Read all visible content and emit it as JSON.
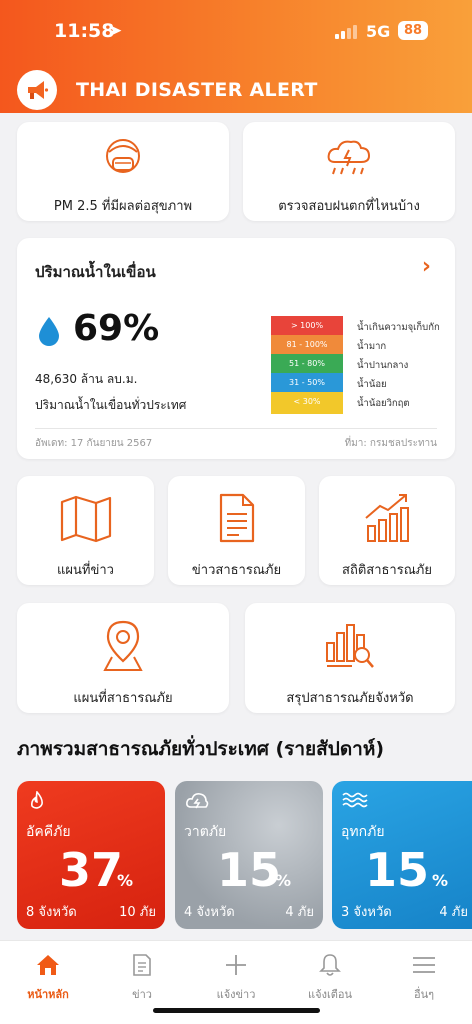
{
  "status_bar": {
    "time": "11:58",
    "network": "5G",
    "battery": "88"
  },
  "app": {
    "title": "THAI DISASTER ALERT"
  },
  "top_tiles": [
    {
      "label": "PM 2.5 ที่มีผลต่อสุขภาพ",
      "icon": "mask-face-icon"
    },
    {
      "label": "ตรวจสอบฝนตกที่ไหนบ้าง",
      "icon": "rain-cloud-icon"
    }
  ],
  "dam": {
    "title": "ปริมาณน้ำในเขื่อน",
    "percent": "69%",
    "volume": "48,630 ล้าน ลบ.ม.",
    "caption": "ปริมาณน้ำในเขื่อนทั่วประเทศ",
    "levels": [
      {
        "label": "> 100%",
        "color": "#e8443a"
      },
      {
        "label": "81 - 100%",
        "color": "#f08a3a"
      },
      {
        "label": "51 - 80%",
        "color": "#3aaa55"
      },
      {
        "label": "31 - 50%",
        "color": "#2a98d8"
      },
      {
        "label": "< 30%",
        "color": "#f2c82a"
      }
    ],
    "legend": [
      "น้ำเกินความจุเก็บกัก",
      "น้ำมาก",
      "น้ำปานกลาง",
      "น้ำน้อย",
      "น้ำน้อยวิกฤต"
    ],
    "updated": "อัพเดท: 17 กันยายน 2567",
    "source": "ที่มา: กรมชลประทาน"
  },
  "menu_tiles_row1": [
    {
      "label": "แผนที่ข่าว",
      "icon": "map-icon"
    },
    {
      "label": "ข่าวสาธารณภัย",
      "icon": "document-icon"
    },
    {
      "label": "สถิติสาธารณภัย",
      "icon": "growth-chart-icon"
    }
  ],
  "menu_tiles_row2": [
    {
      "label": "แผนที่สาธารณภัย",
      "icon": "map-pin-icon"
    },
    {
      "label": "สรุปสาธารณภัยจังหวัด",
      "icon": "bar-search-icon"
    }
  ],
  "overview": {
    "title": "ภาพรวมสาธารณภัยทั่วประเทศ (รายสัปดาห์)",
    "cards": [
      {
        "name": "อัคคีภัย",
        "value": "37",
        "unit": "%",
        "provinces": "8 จังหวัด",
        "incidents": "10 ภัย",
        "color": "#e8321c",
        "icon": "fire-icon"
      },
      {
        "name": "วาตภัย",
        "value": "15",
        "unit": "%",
        "provinces": "4 จังหวัด",
        "incidents": "4 ภัย",
        "color": "#a3a9b0",
        "icon": "storm-icon"
      },
      {
        "name": "อุทกภัย",
        "value": "15",
        "unit": "%",
        "provinces": "3 จังหวัด",
        "incidents": "4 ภัย",
        "color": "#1e96dc",
        "icon": "wave-icon"
      }
    ]
  },
  "tabbar": {
    "items": [
      {
        "label": "หน้าหลัก",
        "icon": "home-icon",
        "active": true
      },
      {
        "label": "ข่าว",
        "icon": "news-icon",
        "active": false
      },
      {
        "label": "แจ้งข่าว",
        "icon": "plus-icon",
        "active": false
      },
      {
        "label": "แจ้งเตือน",
        "icon": "bell-icon",
        "active": false
      },
      {
        "label": "อื่นๆ",
        "icon": "menu-icon",
        "active": false
      }
    ]
  },
  "colors": {
    "accent": "#f26522",
    "icon_orange": "#e8641f"
  }
}
